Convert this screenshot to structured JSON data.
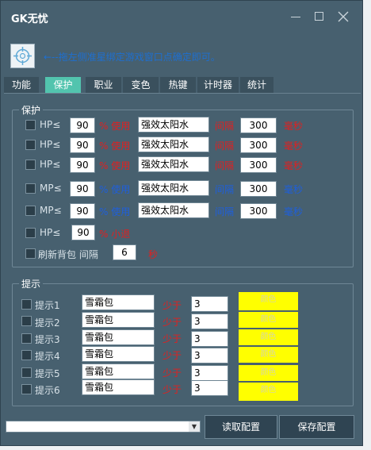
{
  "window": {
    "title": "GK无忧"
  },
  "hint": "←--拖左侧准星绑定游戏窗口点确定即可。",
  "tabs": [
    "功能",
    "保护",
    "职业",
    "变色",
    "热键",
    "计时器",
    "统计"
  ],
  "active_tab": "保护",
  "protect": {
    "legend": "保护",
    "rows": [
      {
        "label": "HP≤",
        "percent": "90",
        "action": "% 使用",
        "item": "强效太阳水",
        "interval_label": "间隔",
        "interval": "300",
        "unit": "毫秒",
        "color": "red"
      },
      {
        "label": "HP≤",
        "percent": "90",
        "action": "% 使用",
        "item": "强效太阳水",
        "interval_label": "间隔",
        "interval": "300",
        "unit": "毫秒",
        "color": "red"
      },
      {
        "label": "HP≤",
        "percent": "90",
        "action": "% 使用",
        "item": "强效太阳水",
        "interval_label": "间隔",
        "interval": "300",
        "unit": "毫秒",
        "color": "red"
      },
      {
        "label": "MP≤",
        "percent": "90",
        "action": "% 使用",
        "item": "强效太阳水",
        "interval_label": "间隔",
        "interval": "300",
        "unit": "毫秒",
        "color": "blue"
      },
      {
        "label": "MP≤",
        "percent": "90",
        "action": "% 使用",
        "item": "强效太阳水",
        "interval_label": "间隔",
        "interval": "300",
        "unit": "毫秒",
        "color": "blue"
      }
    ],
    "exit_row": {
      "label": "HP≤",
      "percent": "90",
      "action": "% 小退"
    },
    "refresh_row": {
      "label": "刷新背包 间隔",
      "value": "6",
      "unit": "秒"
    }
  },
  "tips": {
    "legend": "提示",
    "rows": [
      {
        "label": "提示1",
        "item": "雪霜包",
        "cond": "少于",
        "count": "3",
        "box": "颜色"
      },
      {
        "label": "提示2",
        "item": "雪霜包",
        "cond": "少于",
        "count": "3",
        "box": "颜色"
      },
      {
        "label": "提示3",
        "item": "雪霜包",
        "cond": "少于",
        "count": "3",
        "box": "颜色"
      },
      {
        "label": "提示4",
        "item": "雪霜包",
        "cond": "少于",
        "count": "3",
        "box": "颜色"
      },
      {
        "label": "提示5",
        "item": "雪霜包",
        "cond": "少于",
        "count": "3",
        "box": "颜色"
      },
      {
        "label": "提示6",
        "item": "雪霜包",
        "cond": "少于",
        "count": "3",
        "box": "颜色"
      }
    ]
  },
  "footer": {
    "combo_value": "",
    "read_config": "读取配置",
    "save_config": "保存配置"
  },
  "colors": {
    "window_bg": "#47606f",
    "tab_active": "#52c4ae",
    "red": "#e02020",
    "blue": "#1e5fdc",
    "highlight": "#ffff00"
  }
}
